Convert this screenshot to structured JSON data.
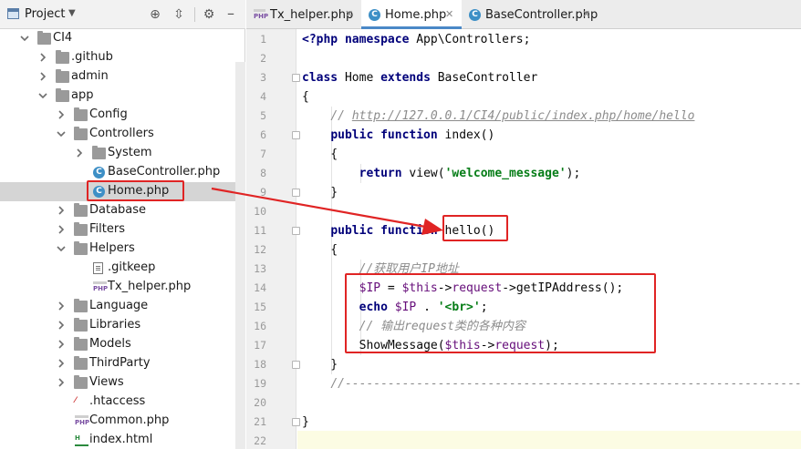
{
  "project_panel": {
    "title": "Project",
    "tree": [
      {
        "label": "CI4",
        "kind": "folder",
        "expanded": true,
        "depth": 0
      },
      {
        "label": ".github",
        "kind": "folder",
        "expanded": false,
        "depth": 1
      },
      {
        "label": "admin",
        "kind": "folder",
        "expanded": false,
        "depth": 1
      },
      {
        "label": "app",
        "kind": "folder",
        "expanded": true,
        "depth": 1
      },
      {
        "label": "Config",
        "kind": "folder",
        "expanded": false,
        "depth": 2
      },
      {
        "label": "Controllers",
        "kind": "folder",
        "expanded": true,
        "depth": 2
      },
      {
        "label": "System",
        "kind": "folder",
        "expanded": false,
        "depth": 3
      },
      {
        "label": "BaseController.php",
        "kind": "class",
        "depth": 3
      },
      {
        "label": "Home.php",
        "kind": "class",
        "depth": 3,
        "selected": true
      },
      {
        "label": "Database",
        "kind": "folder",
        "expanded": false,
        "depth": 2
      },
      {
        "label": "Filters",
        "kind": "folder",
        "expanded": false,
        "depth": 2
      },
      {
        "label": "Helpers",
        "kind": "folder",
        "expanded": true,
        "depth": 2
      },
      {
        "label": ".gitkeep",
        "kind": "text",
        "depth": 3
      },
      {
        "label": "Tx_helper.php",
        "kind": "php",
        "depth": 3
      },
      {
        "label": "Language",
        "kind": "folder",
        "expanded": false,
        "depth": 2
      },
      {
        "label": "Libraries",
        "kind": "folder",
        "expanded": false,
        "depth": 2
      },
      {
        "label": "Models",
        "kind": "folder",
        "expanded": false,
        "depth": 2
      },
      {
        "label": "ThirdParty",
        "kind": "folder",
        "expanded": false,
        "depth": 2
      },
      {
        "label": "Views",
        "kind": "folder",
        "expanded": false,
        "depth": 2
      },
      {
        "label": ".htaccess",
        "kind": "htaccess",
        "depth": 2
      },
      {
        "label": "Common.php",
        "kind": "php",
        "depth": 2
      },
      {
        "label": "index.html",
        "kind": "html",
        "depth": 2
      }
    ]
  },
  "tabs": [
    {
      "label": "Tx_helper.php",
      "icon": "php-file-icon",
      "active": false
    },
    {
      "label": "Home.php",
      "icon": "class-file-icon",
      "active": true
    },
    {
      "label": "BaseController.php",
      "icon": "class-file-icon",
      "active": false
    }
  ],
  "line_numbers": [
    "1",
    "2",
    "3",
    "4",
    "5",
    "6",
    "7",
    "8",
    "9",
    "10",
    "11",
    "12",
    "13",
    "14",
    "15",
    "16",
    "17",
    "18",
    "19",
    "20",
    "21",
    "22"
  ],
  "code_lines": [
    [
      [
        "kw",
        "<?php namespace "
      ],
      [
        "",
        "App\\Controllers;"
      ]
    ],
    [],
    [
      [
        "kw",
        "class "
      ],
      [
        "",
        "Home "
      ],
      [
        "kw",
        "extends "
      ],
      [
        "",
        "BaseController"
      ]
    ],
    [
      [
        "",
        "{"
      ]
    ],
    [
      [
        "",
        "    "
      ],
      [
        "cmt",
        "// "
      ],
      [
        "cmt url",
        "http://127.0.0.1/CI4/public/index.php/home/hello"
      ]
    ],
    [
      [
        "",
        "    "
      ],
      [
        "kw",
        "public function "
      ],
      [
        "",
        "index()"
      ]
    ],
    [
      [
        "",
        "    {"
      ]
    ],
    [
      [
        "",
        "        "
      ],
      [
        "kw",
        "return "
      ],
      [
        "",
        "view("
      ],
      [
        "str",
        "'welcome_message'"
      ],
      [
        "",
        ");"
      ]
    ],
    [
      [
        "",
        "    }"
      ]
    ],
    [],
    [
      [
        "",
        "    "
      ],
      [
        "kw",
        "public function "
      ],
      [
        "",
        "hello()"
      ]
    ],
    [
      [
        "",
        "    {"
      ]
    ],
    [
      [
        "",
        "        "
      ],
      [
        "cmt",
        "//获取用户IP地址"
      ]
    ],
    [
      [
        "",
        "        "
      ],
      [
        "var",
        "$IP"
      ],
      [
        "",
        " = "
      ],
      [
        "var",
        "$this"
      ],
      [
        "",
        "->"
      ],
      [
        "var",
        "request"
      ],
      [
        "",
        "->getIPAddress();"
      ]
    ],
    [
      [
        "",
        "        "
      ],
      [
        "kw",
        "echo "
      ],
      [
        "var",
        "$IP"
      ],
      [
        "",
        " . "
      ],
      [
        "str",
        "'<br>'"
      ],
      [
        "",
        ";"
      ]
    ],
    [
      [
        "",
        "        "
      ],
      [
        "cmt",
        "// 输出request类的各种内容"
      ]
    ],
    [
      [
        "",
        "        "
      ],
      [
        "",
        "ShowMessage("
      ],
      [
        "var",
        "$this"
      ],
      [
        "",
        "->"
      ],
      [
        "var",
        "request"
      ],
      [
        "",
        ");"
      ]
    ],
    [
      [
        "",
        "    }"
      ]
    ],
    [
      [
        "",
        "    "
      ],
      [
        "cmt",
        "//-----------------------------------------------------------------"
      ]
    ],
    [],
    [
      [
        "",
        "}"
      ]
    ],
    []
  ],
  "colors": {
    "annotation": "#e02424",
    "selection": "#d5d5d5",
    "active_tab_underline": "#4a88c7"
  }
}
